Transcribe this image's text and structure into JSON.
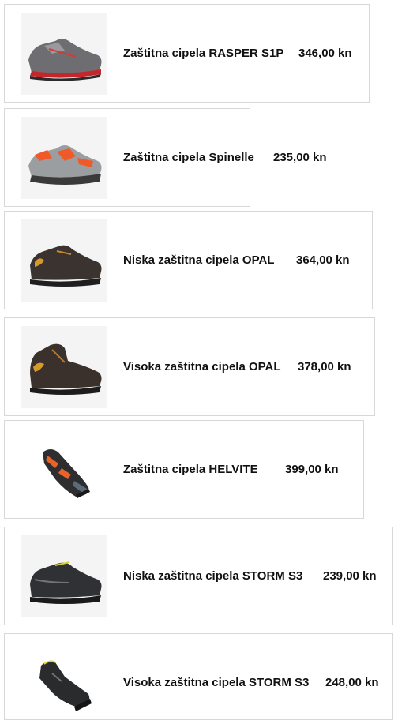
{
  "products": [
    {
      "name": "Zaštitna cipela RASPER S1P",
      "price": "346,00 kn",
      "icon": "low-safety-shoe-grey-red-icon"
    },
    {
      "name": "Zaštitna cipela Spinelle",
      "price": "235,00 kn",
      "icon": "low-safety-shoe-grey-orange-icon"
    },
    {
      "name": "Niska zaštitna cipela OPAL",
      "price": "364,00 kn",
      "icon": "low-safety-shoe-black-icon"
    },
    {
      "name": "Visoka zaštitna cipela OPAL",
      "price": "378,00 kn",
      "icon": "high-safety-boot-black-icon"
    },
    {
      "name": "Zaštitna cipela HELVITE",
      "price": "399,00 kn",
      "icon": "safety-sandal-black-orange-icon"
    },
    {
      "name": "Niska zaštitna cipela STORM S3",
      "price": "239,00 kn",
      "icon": "low-safety-shoe-black-yellow-icon"
    },
    {
      "name": "Visoka zaštitna cipela STORM S3",
      "price": "248,00 kn",
      "icon": "high-safety-boot-black-yellow-icon"
    }
  ],
  "colors": {
    "border": "#d8d8d8",
    "text": "#111111",
    "thumb_bg": "#f4f4f4"
  }
}
